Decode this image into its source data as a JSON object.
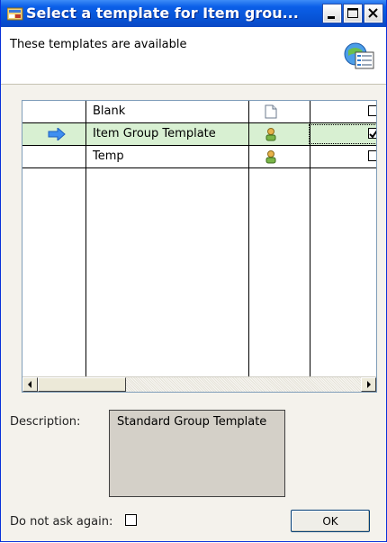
{
  "window": {
    "title": "Select a template for Item grou...",
    "title_bar_color": "#0753d5"
  },
  "header": {
    "text": "These templates are available"
  },
  "grid": {
    "rows": [
      {
        "name": "Blank",
        "icon": "blank-document-icon",
        "checked": false,
        "selected": false
      },
      {
        "name": "Item Group Template",
        "icon": "user-template-icon",
        "checked": true,
        "selected": true
      },
      {
        "name": "Temp",
        "icon": "user-template-icon",
        "checked": false,
        "selected": false
      }
    ],
    "selected_row_color": "#d8f0d2"
  },
  "description": {
    "label": "Description:",
    "value": "Standard Group Template"
  },
  "footer": {
    "do_not_ask_label": "Do not ask again:",
    "do_not_ask_checked": false,
    "ok_label": "OK"
  }
}
